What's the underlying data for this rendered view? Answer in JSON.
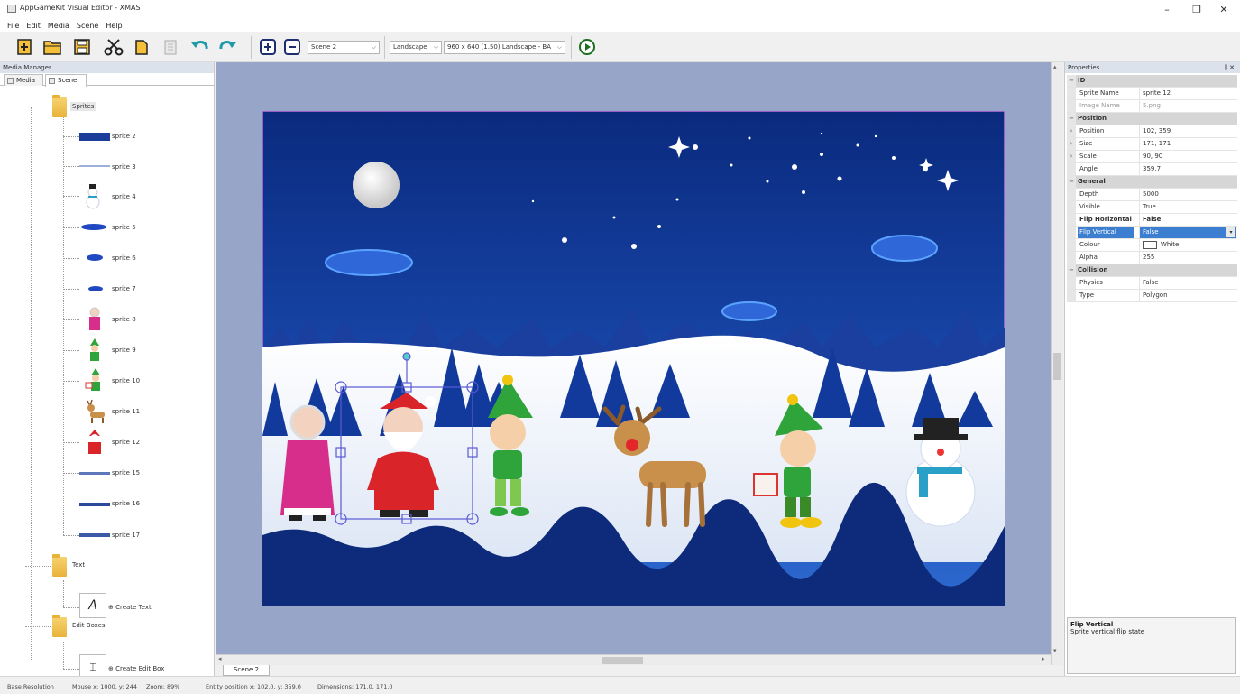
{
  "window": {
    "title": "AppGameKit Visual Editor - XMAS",
    "controls": {
      "minimize": "–",
      "restore": "❐",
      "close": "✕"
    }
  },
  "menu": [
    "File",
    "Edit",
    "Media",
    "Scene",
    "Help"
  ],
  "toolbar": {
    "buttons": [
      "new-icon",
      "open-icon",
      "save-icon",
      "cut-icon",
      "copy-icon",
      "paste-icon",
      "undo-icon",
      "redo-icon",
      "zoom-in-icon",
      "zoom-out-icon",
      "play-icon"
    ],
    "scene_select": "Scene 2",
    "orientation_select": "Landscape",
    "resolution_select": "960 x 640 (1.50) Landscape - BA"
  },
  "media_manager": {
    "title": "Media Manager",
    "tabs": [
      "Media",
      "Scene"
    ],
    "active_tab": "Scene",
    "groups": [
      {
        "label": "Sprites",
        "items": [
          "sprite 2",
          "sprite 3",
          "sprite 4",
          "sprite 5",
          "sprite 6",
          "sprite 7",
          "sprite 8",
          "sprite 9",
          "sprite 10",
          "sprite 11",
          "sprite 12",
          "sprite 15",
          "sprite 16",
          "sprite 17"
        ]
      },
      {
        "label": "Text",
        "items": [
          "Create Text"
        ]
      },
      {
        "label": "Edit Boxes",
        "items": [
          "Create Edit Box"
        ]
      }
    ]
  },
  "properties": {
    "title": "Properties",
    "pin": "⫼ ✕",
    "rows": [
      {
        "type": "cat",
        "k": "ID"
      },
      {
        "type": "row",
        "k": "Sprite Name",
        "v": "sprite 12"
      },
      {
        "type": "row",
        "k": "Image Name",
        "v": "5.png",
        "dim": true
      },
      {
        "type": "cat",
        "k": "Position"
      },
      {
        "type": "row",
        "k": "Position",
        "v": "102, 359",
        "exp": true
      },
      {
        "type": "row",
        "k": "Size",
        "v": "171, 171",
        "exp": true
      },
      {
        "type": "row",
        "k": "Scale",
        "v": "90, 90",
        "exp": true
      },
      {
        "type": "row",
        "k": "Angle",
        "v": "359.7"
      },
      {
        "type": "cat",
        "k": "General"
      },
      {
        "type": "row",
        "k": "Depth",
        "v": "5000"
      },
      {
        "type": "row",
        "k": "Visible",
        "v": "True"
      },
      {
        "type": "row",
        "k": "Flip Horizontal",
        "v": "False",
        "bold": true
      },
      {
        "type": "sel",
        "k": "Flip Vertical",
        "v": "False"
      },
      {
        "type": "row",
        "k": "Colour",
        "v": "White",
        "swatch": true
      },
      {
        "type": "row",
        "k": "Alpha",
        "v": "255"
      },
      {
        "type": "cat",
        "k": "Collision"
      },
      {
        "type": "row",
        "k": "Physics",
        "v": "False"
      },
      {
        "type": "row",
        "k": "Type",
        "v": "Polygon"
      }
    ],
    "help_title": "Flip Vertical",
    "help_text": "Sprite vertical flip state"
  },
  "scene_tab": "Scene 2",
  "status": {
    "base_resolution": "Base Resolution",
    "mouse": "Mouse x: 1000, y: 244",
    "zoom": "Zoom: 89%",
    "entity_position": "Entity position x: 102.0, y: 359.0",
    "dimensions": "Dimensions: 171.0, 171.0"
  },
  "colors": {
    "night_sky": "#0f2f86",
    "snow": "#ffffff",
    "selection": "#5a5ad6",
    "canvas_bg": "#97a5c9"
  }
}
